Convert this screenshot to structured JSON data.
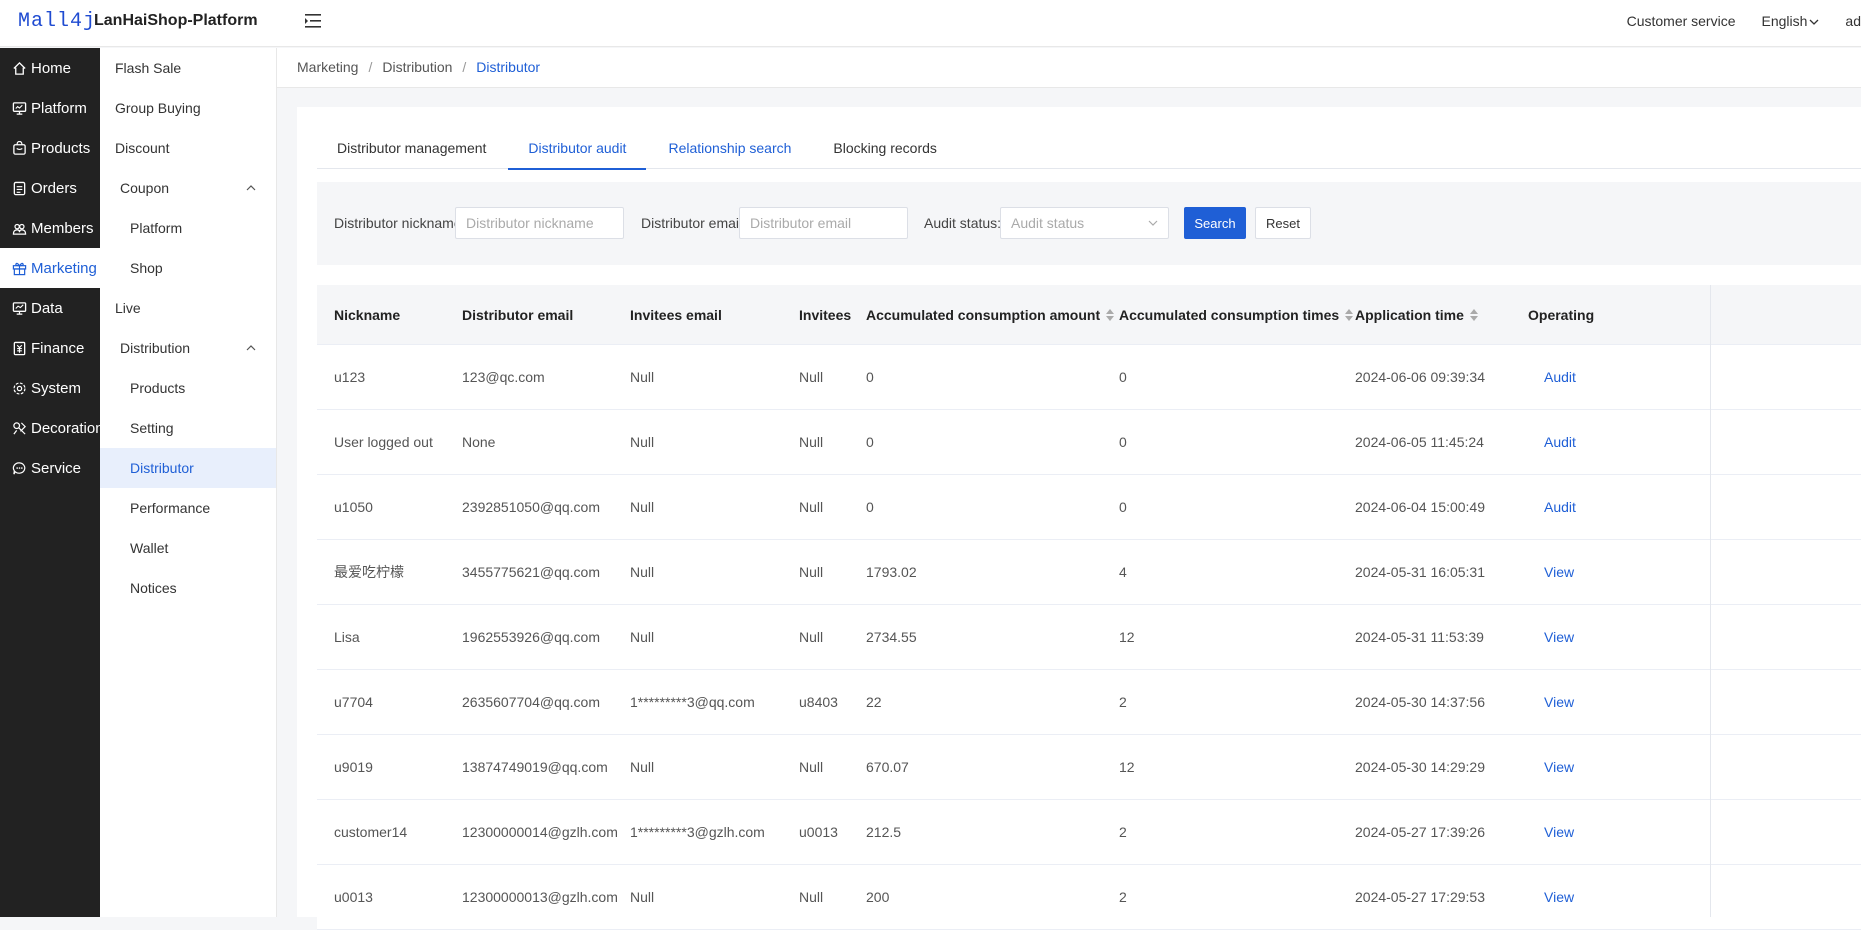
{
  "header": {
    "logo": "Mall4j",
    "brand": "LanHaiShop-Platform",
    "customer_service": "Customer service",
    "language": "English",
    "user": "ad"
  },
  "primary_nav": [
    {
      "label": "Home",
      "icon": "home-icon"
    },
    {
      "label": "Platform",
      "icon": "monitor-icon"
    },
    {
      "label": "Products",
      "icon": "bag-icon"
    },
    {
      "label": "Orders",
      "icon": "document-icon"
    },
    {
      "label": "Members",
      "icon": "people-icon"
    },
    {
      "label": "Marketing",
      "icon": "gift-icon",
      "active": true
    },
    {
      "label": "Data",
      "icon": "chart-icon"
    },
    {
      "label": "Finance",
      "icon": "finance-icon"
    },
    {
      "label": "System",
      "icon": "gear-icon"
    },
    {
      "label": "Decoration",
      "icon": "palette-icon"
    },
    {
      "label": "Service",
      "icon": "chat-icon"
    }
  ],
  "secondary_nav": [
    {
      "label": "Flash Sale",
      "level": 1
    },
    {
      "label": "Group Buying",
      "level": 1
    },
    {
      "label": "Discount",
      "level": 1
    },
    {
      "label": "Coupon",
      "level": "group",
      "expanded": true
    },
    {
      "label": "Platform",
      "level": 2
    },
    {
      "label": "Shop",
      "level": 2
    },
    {
      "label": "Live",
      "level": 1
    },
    {
      "label": "Distribution",
      "level": "group",
      "expanded": true
    },
    {
      "label": "Products",
      "level": 2
    },
    {
      "label": "Setting",
      "level": 2
    },
    {
      "label": "Distributor",
      "level": 2,
      "active": true
    },
    {
      "label": "Performance",
      "level": 2
    },
    {
      "label": "Wallet",
      "level": 2
    },
    {
      "label": "Notices",
      "level": 2
    }
  ],
  "breadcrumb": [
    "Marketing",
    "Distribution",
    "Distributor"
  ],
  "tabs": [
    {
      "label": "Distributor management",
      "state": "normal"
    },
    {
      "label": "Distributor audit",
      "state": "active"
    },
    {
      "label": "Relationship search",
      "state": "link"
    },
    {
      "label": "Blocking records",
      "state": "normal"
    }
  ],
  "filters": {
    "nickname_label": "Distributor nickname:",
    "nickname_placeholder": "Distributor nickname",
    "email_label": "Distributor email:",
    "email_placeholder": "Distributor email",
    "status_label": "Audit status:",
    "status_placeholder": "Audit status",
    "search_button": "Search",
    "reset_button": "Reset"
  },
  "table": {
    "columns": [
      "Nickname",
      "Distributor email",
      "Invitees email",
      "Invitees",
      "Accumulated consumption amount",
      "Accumulated consumption times",
      "Application time",
      "Operating"
    ],
    "rows": [
      [
        "u123",
        "123@qc.com",
        "Null",
        "Null",
        "0",
        "0",
        "2024-06-06 09:39:34",
        "Audit"
      ],
      [
        "User logged out",
        "None",
        "Null",
        "Null",
        "0",
        "0",
        "2024-06-05 11:45:24",
        "Audit"
      ],
      [
        "u1050",
        "2392851050@qq.com",
        "Null",
        "Null",
        "0",
        "0",
        "2024-06-04 15:00:49",
        "Audit"
      ],
      [
        "最爱吃柠檬",
        "3455775621@qq.com",
        "Null",
        "Null",
        "1793.02",
        "4",
        "2024-05-31 16:05:31",
        "View"
      ],
      [
        "Lisa",
        "1962553926@qq.com",
        "Null",
        "Null",
        "2734.55",
        "12",
        "2024-05-31 11:53:39",
        "View"
      ],
      [
        "u7704",
        "2635607704@qq.com",
        "1*********3@qq.com",
        "u8403",
        "22",
        "2",
        "2024-05-30 14:37:56",
        "View"
      ],
      [
        "u9019",
        "13874749019@qq.com",
        "Null",
        "Null",
        "670.07",
        "12",
        "2024-05-30 14:29:29",
        "View"
      ],
      [
        "customer14",
        "12300000014@gzlh.com",
        "1*********3@gzlh.com",
        "u0013",
        "212.5",
        "2",
        "2024-05-27 17:39:26",
        "View"
      ],
      [
        "u0013",
        "12300000013@gzlh.com",
        "Null",
        "Null",
        "200",
        "2",
        "2024-05-27 17:29:53",
        "View"
      ]
    ]
  },
  "colors": {
    "accent": "#1f5fd6",
    "sidebar_bg": "#222222"
  }
}
